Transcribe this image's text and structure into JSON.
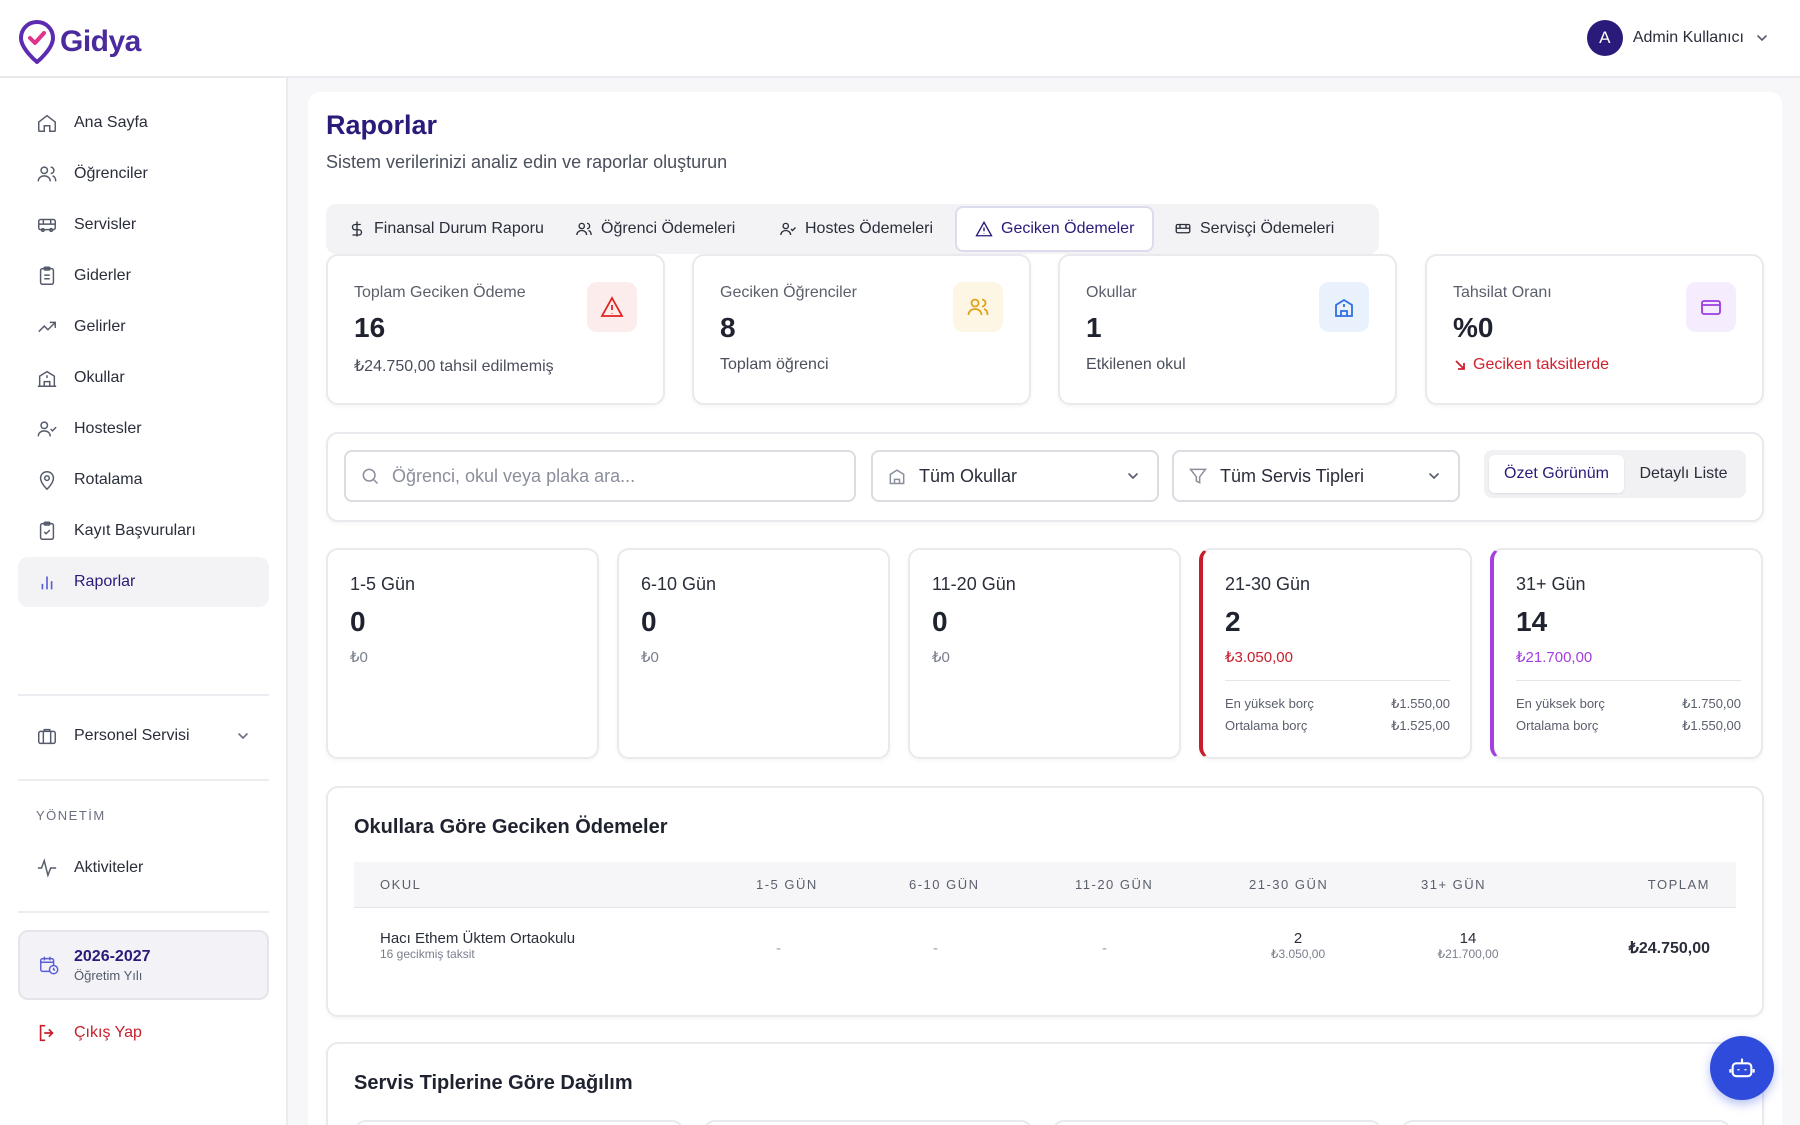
{
  "app": {
    "brand": "Gidya"
  },
  "user": {
    "initial": "A",
    "name": "Admin Kullanıcı"
  },
  "sidebar": {
    "items": [
      {
        "label": "Ana Sayfa",
        "icon": "home-icon"
      },
      {
        "label": "Öğrenciler",
        "icon": "users-icon"
      },
      {
        "label": "Servisler",
        "icon": "bus-icon"
      },
      {
        "label": "Giderler",
        "icon": "clipboard-icon"
      },
      {
        "label": "Gelirler",
        "icon": "trending-up-icon"
      },
      {
        "label": "Okullar",
        "icon": "school-icon"
      },
      {
        "label": "Hostesler",
        "icon": "user-check-icon"
      },
      {
        "label": "Rotalama",
        "icon": "map-pin-icon"
      },
      {
        "label": "Kayıt Başvuruları",
        "icon": "clipboard-check-icon"
      },
      {
        "label": "Raporlar",
        "icon": "bar-chart-icon",
        "active": true
      }
    ],
    "personel": "Personel Servisi",
    "section_label": "YÖNETİM",
    "activities": "Aktiviteler",
    "year": {
      "title": "2026-2027",
      "subtitle": "Öğretim Yılı"
    },
    "logout": "Çıkış Yap"
  },
  "page": {
    "title": "Raporlar",
    "subtitle": "Sistem verilerinizi analiz edin ve raporlar oluşturun"
  },
  "tabs": [
    {
      "label": "Finansal Durum Raporu",
      "icon": "dollar-icon"
    },
    {
      "label": "Öğrenci Ödemeleri",
      "icon": "users-icon"
    },
    {
      "label": "Hostes Ödemeleri",
      "icon": "user-check-icon"
    },
    {
      "label": "Geciken Ödemeler",
      "icon": "alert-triangle-icon",
      "active": true
    },
    {
      "label": "Servisçi Ödemeleri",
      "icon": "bus-icon"
    }
  ],
  "stats": [
    {
      "label": "Toplam Geciken Ödeme",
      "value": "16",
      "sub": "₺24.750,00 tahsil edilmemiş",
      "icon": "alert-triangle-icon",
      "color": "#e02424",
      "bg": "#fdecec"
    },
    {
      "label": "Geciken Öğrenciler",
      "value": "8",
      "sub": "Toplam öğrenci",
      "icon": "users-icon",
      "color": "#e0a21a",
      "bg": "#fdf6e4"
    },
    {
      "label": "Okullar",
      "value": "1",
      "sub": "Etkilenen okul",
      "icon": "school-icon",
      "color": "#2f6fe0",
      "bg": "#e9f1fd"
    },
    {
      "label": "Tahsilat Oranı",
      "value": "%0",
      "sub": "Geciken taksitlerde",
      "icon": "card-icon",
      "color": "#9b3ce0",
      "bg": "#f5edfd",
      "sub_color": "#d0202e"
    }
  ],
  "filters": {
    "search_placeholder": "Öğrenci, okul veya plaka ara...",
    "schools": "Tüm Okullar",
    "service_types": "Tüm Servis Tipleri",
    "view_summary": "Özet Görünüm",
    "view_detail": "Detaylı Liste"
  },
  "buckets": [
    {
      "title": "1-5 Gün",
      "count": "0",
      "amount": "₺0"
    },
    {
      "title": "6-10 Gün",
      "count": "0",
      "amount": "₺0"
    },
    {
      "title": "11-20 Gün",
      "count": "0",
      "amount": "₺0"
    },
    {
      "title": "21-30 Gün",
      "count": "2",
      "amount": "₺3.050,00",
      "accent": "#c81e2c",
      "max_label": "En yüksek borç",
      "max": "₺1.550,00",
      "avg_label": "Ortalama borç",
      "avg": "₺1.525,00"
    },
    {
      "title": "31+ Gün",
      "count": "14",
      "amount": "₺21.700,00",
      "accent": "#a53fe0",
      "max_label": "En yüksek borç",
      "max": "₺1.750,00",
      "avg_label": "Ortalama borç",
      "avg": "₺1.550,00"
    }
  ],
  "school_table": {
    "title": "Okullara Göre Geciken Ödemeler",
    "headers": [
      "OKUL",
      "1-5 GÜN",
      "6-10 GÜN",
      "11-20 GÜN",
      "21-30 GÜN",
      "31+ GÜN",
      "TOPLAM"
    ],
    "rows": [
      {
        "school": "Hacı Ethem Üktem Ortaokulu",
        "school_sub": "16 gecikmiş taksit",
        "d1": "-",
        "d2": "-",
        "d3": "-",
        "d4": "2",
        "d4_sub": "₺3.050,00",
        "d5": "14",
        "d5_sub": "₺21.700,00",
        "total": "₺24.750,00"
      }
    ]
  },
  "service_section": {
    "title": "Servis Tiplerine Göre Dağılım"
  }
}
